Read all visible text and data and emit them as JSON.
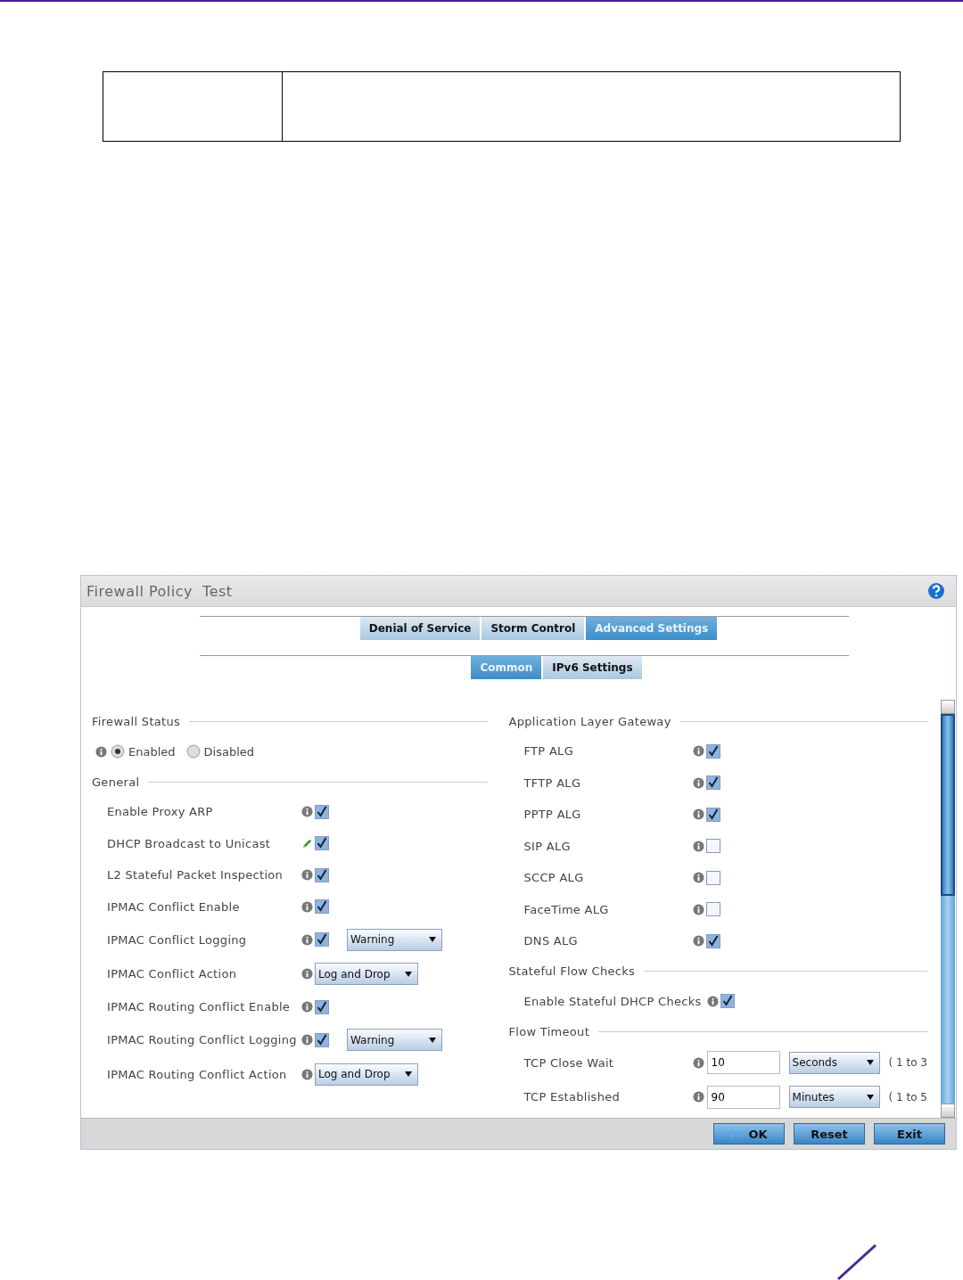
{
  "window": {
    "title": "Firewall Policy  Test"
  },
  "tabs": [
    {
      "label": "Denial of Service",
      "selected": false
    },
    {
      "label": "Storm Control",
      "selected": false
    },
    {
      "label": "Advanced Settings",
      "selected": true
    }
  ],
  "subtabs": [
    {
      "label": "Common",
      "selected": true
    },
    {
      "label": "IPv6 Settings",
      "selected": false
    }
  ],
  "firewall_status": {
    "title": "Firewall Status",
    "options": [
      {
        "label": "Enabled",
        "selected": true
      },
      {
        "label": "Disabled",
        "selected": false
      }
    ]
  },
  "general": {
    "title": "General",
    "rows": [
      {
        "kind": "checkbox",
        "label": "Enable Proxy ARP",
        "modified": false,
        "checked": true
      },
      {
        "kind": "checkbox",
        "label": "DHCP Broadcast to Unicast",
        "modified": true,
        "checked": true
      },
      {
        "kind": "checkbox",
        "label": "L2 Stateful Packet Inspection",
        "modified": false,
        "checked": true
      },
      {
        "kind": "checkbox",
        "label": "IPMAC Conflict Enable",
        "modified": false,
        "checked": true
      },
      {
        "kind": "checkbox_dropdown",
        "label": "IPMAC Conflict Logging",
        "modified": false,
        "checked": true,
        "value": "Warning"
      },
      {
        "kind": "dropdown",
        "label": "IPMAC Conflict Action",
        "modified": false,
        "value": "Log and Drop"
      },
      {
        "kind": "checkbox",
        "label": "IPMAC Routing Conflict Enable",
        "modified": false,
        "checked": true
      },
      {
        "kind": "checkbox_dropdown",
        "label": "IPMAC Routing Conflict Logging",
        "modified": false,
        "checked": true,
        "value": "Warning"
      },
      {
        "kind": "dropdown",
        "label": "IPMAC Routing Conflict Action",
        "modified": false,
        "value": "Log and Drop"
      }
    ]
  },
  "alg": {
    "title": "Application Layer Gateway",
    "rows": [
      {
        "label": "FTP ALG",
        "checked": true
      },
      {
        "label": "TFTP ALG",
        "checked": true
      },
      {
        "label": "PPTP ALG",
        "checked": true
      },
      {
        "label": "SIP ALG",
        "checked": false
      },
      {
        "label": "SCCP ALG",
        "checked": false
      },
      {
        "label": "FaceTime ALG",
        "checked": false
      },
      {
        "label": "DNS ALG",
        "checked": true
      }
    ]
  },
  "stateful_flow_checks": {
    "title": "Stateful Flow Checks",
    "rows": [
      {
        "label": "Enable Stateful DHCP Checks",
        "checked": true
      }
    ]
  },
  "flow_timeout": {
    "title": "Flow Timeout",
    "rows": [
      {
        "label": "TCP Close Wait",
        "value": "10",
        "unit": "Seconds",
        "range": "( 1 to 3"
      },
      {
        "label": "TCP Established",
        "value": "90",
        "unit": "Minutes",
        "range": "( 1 to 5"
      }
    ]
  },
  "buttons": [
    {
      "label": "OK",
      "kind": "primary"
    },
    {
      "label": "Reset",
      "kind": "normal"
    },
    {
      "label": "Exit",
      "kind": "normal"
    }
  ]
}
